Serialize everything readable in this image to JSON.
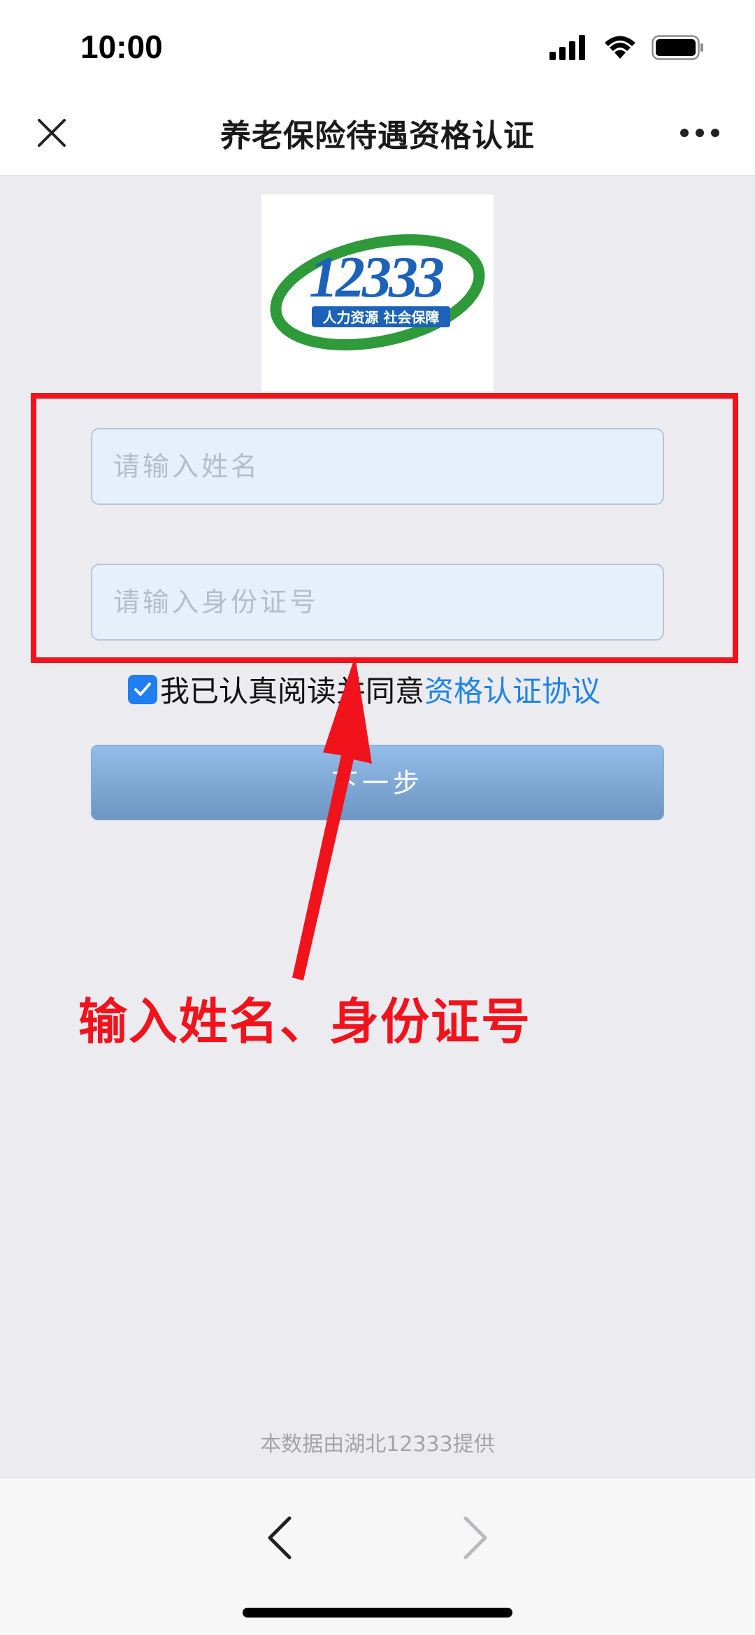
{
  "status_bar": {
    "time": "10:00"
  },
  "nav_bar": {
    "title": "养老保险待遇资格认证"
  },
  "logo": {
    "number": "12333",
    "slogan": "人力资源 社会保障"
  },
  "form": {
    "name_placeholder": "请输入姓名",
    "id_placeholder": "请输入身份证号"
  },
  "agreement": {
    "checked": true,
    "text": "我已认真阅读并同意",
    "link": "资格认证协议"
  },
  "next_button": {
    "label": "下一步"
  },
  "annotation": {
    "text": "输入姓名、身份证号"
  },
  "footer": {
    "note": "本数据由湖北12333提供"
  },
  "colors": {
    "highlight": "#f0131c",
    "link": "#1f84e8",
    "button": "#7ea7d4",
    "logo_green": "#2f9a3a",
    "logo_blue": "#1c62b8"
  },
  "icons": [
    "close-icon",
    "more-icon",
    "signal-icon",
    "wifi-icon",
    "battery-icon",
    "check-icon",
    "chevron-left-icon",
    "chevron-right-icon"
  ]
}
